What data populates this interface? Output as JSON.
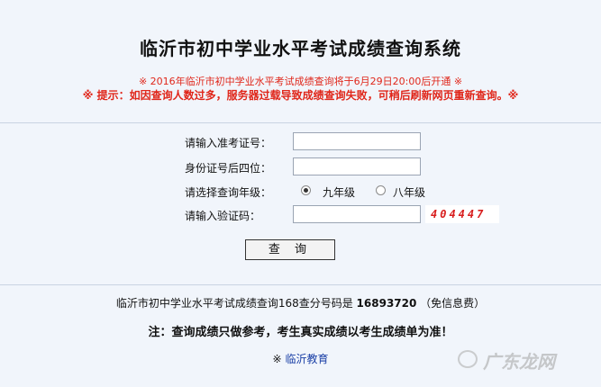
{
  "header": {
    "title": "临沂市初中学业水平考试成绩查询系统",
    "notice_open": "※  2016年临沂市初中学业水平考试成绩查询将于6月29日20:00后开通  ※",
    "notice_tip": "※ 提示：如因查询人数过多，服务器过载导致成绩查询失败，可稍后刷新网页重新查询。※"
  },
  "form": {
    "exam_no_label": "请输入准考证号：",
    "exam_no_value": "",
    "id_last4_label": "身份证号后四位：",
    "id_last4_value": "",
    "grade_label": "请选择查询年级：",
    "grade_options": [
      {
        "label": "九年级",
        "checked": true
      },
      {
        "label": "八年级",
        "checked": false
      }
    ],
    "captcha_label": "请输入验证码：",
    "captcha_value": "",
    "captcha_code": "404447",
    "submit_label": "查 询"
  },
  "footer": {
    "sms_text": "临沂市初中学业水平考试成绩查询168查分号码是",
    "sms_number": "16893720",
    "sms_note": "（免信息费）",
    "disclaimer": "注：查询成绩只做参考，考生真实成绩以考生成绩单为准！",
    "link_prefix": "※",
    "link_text": "临沂教育",
    "watermark": "广东龙网"
  },
  "colors": {
    "background": "#f1f5fb",
    "notice_red": "#e0261a",
    "link_blue": "#1a3fa6",
    "captcha_red": "#d81e1e"
  }
}
